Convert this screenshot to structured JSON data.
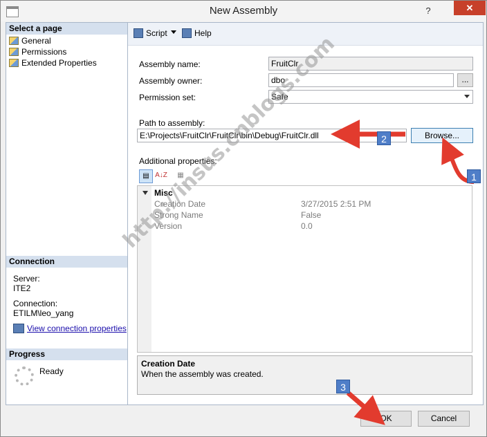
{
  "window": {
    "title": "New Assembly",
    "help_glyph": "?",
    "close_glyph": "✕"
  },
  "sidebar": {
    "select_page_heading": "Select a page",
    "pages": [
      {
        "label": "General",
        "icon": "page-icon"
      },
      {
        "label": "Permissions",
        "icon": "page-icon"
      },
      {
        "label": "Extended Properties",
        "icon": "page-icon"
      }
    ],
    "connection": {
      "heading": "Connection",
      "server_label": "Server:",
      "server_value": "ITE2",
      "connection_label": "Connection:",
      "connection_value": "ETILM\\leo_yang",
      "view_link": "View connection properties"
    },
    "progress": {
      "heading": "Progress",
      "status": "Ready"
    }
  },
  "toolbar": {
    "script_label": "Script",
    "help_label": "Help"
  },
  "form": {
    "assembly_name_label": "Assembly name:",
    "assembly_name_value": "FruitClr",
    "assembly_owner_label": "Assembly owner:",
    "assembly_owner_value": "dbo",
    "ellipsis_label": "...",
    "permission_set_label": "Permission set:",
    "permission_set_value": "Safe",
    "path_label": "Path to assembly:",
    "path_value": "E:\\Projects\\FruitClr\\FruitClr\\bin\\Debug\\FruitClr.dll",
    "browse_label": "Browse...",
    "additional_label": "Additional properties:"
  },
  "properties": {
    "sort_az_glyph": "A↓Z",
    "category": "Misc",
    "rows": [
      {
        "name": "Creation Date",
        "value": "3/27/2015 2:51 PM"
      },
      {
        "name": "Strong Name",
        "value": "False"
      },
      {
        "name": "Version",
        "value": "0.0"
      }
    ]
  },
  "description": {
    "title": "Creation Date",
    "text": "When the assembly was created."
  },
  "buttons": {
    "ok_label": "OK",
    "cancel_label": "Cancel"
  },
  "annotations": {
    "badge1": "1",
    "badge2": "2",
    "badge3": "3"
  },
  "watermark": "http://insus.cnblogs.com",
  "colors": {
    "arrow": "#e23b2e",
    "badge": "#4f7ec8",
    "close": "#c7402a",
    "header": "#d5e0ee"
  }
}
